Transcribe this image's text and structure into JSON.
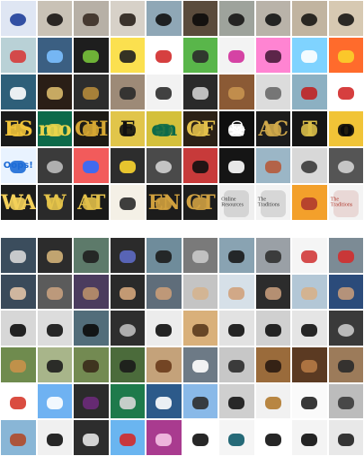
{
  "grids": {
    "top": {
      "rows": [
        [
          {
            "subject": "eye-closeup",
            "bg": "#dfe6f3",
            "fg": "#1f3f9a",
            "label": ""
          },
          {
            "subject": "dog-nose",
            "bg": "#c9c2b6",
            "fg": "#1a1614",
            "label": ""
          },
          {
            "subject": "dog-face",
            "bg": "#b7b0a6",
            "fg": "#3a2e25",
            "label": ""
          },
          {
            "subject": "dog-face",
            "bg": "#d7d1c8",
            "fg": "#2a211b",
            "label": ""
          },
          {
            "subject": "dog-nose",
            "bg": "#8fa7b6",
            "fg": "#121212",
            "label": ""
          },
          {
            "subject": "dog-mouth",
            "bg": "#5a4b3c",
            "fg": "#0c0b0a",
            "label": ""
          },
          {
            "subject": "dog-nose",
            "bg": "#9ea39c",
            "fg": "#161616",
            "label": ""
          },
          {
            "subject": "dog-nose",
            "bg": "#b9b3a9",
            "fg": "#141414",
            "label": ""
          },
          {
            "subject": "dog-nose",
            "bg": "#c1b4a0",
            "fg": "#1a1714",
            "label": ""
          },
          {
            "subject": "dog-nose",
            "bg": "#d7c9b2",
            "fg": "#1a1714",
            "label": ""
          }
        ],
        [
          {
            "subject": "graphic",
            "bg": "#b9d1d6",
            "fg": "#d63b3b",
            "label": ""
          },
          {
            "subject": "graphic",
            "bg": "#3b5f82",
            "fg": "#7cc0ff",
            "label": ""
          },
          {
            "subject": "graphic",
            "bg": "#1e1e1e",
            "fg": "#77c23a",
            "label": ""
          },
          {
            "subject": "graphic",
            "bg": "#fbe04f",
            "fg": "#1f1f1f",
            "label": ""
          },
          {
            "subject": "graphic",
            "bg": "#ffffff",
            "fg": "#d22b2b",
            "label": ""
          },
          {
            "subject": "graphic",
            "bg": "#59b64a",
            "fg": "#2b2b2b",
            "label": ""
          },
          {
            "subject": "graphic",
            "bg": "#f3f3f3",
            "fg": "#d2309b",
            "label": ""
          },
          {
            "subject": "graphic",
            "bg": "#ff84d2",
            "fg": "#4a1b3a",
            "label": ""
          },
          {
            "subject": "graphic",
            "bg": "#7fd3ff",
            "fg": "#ffffff",
            "label": ""
          },
          {
            "subject": "graphic",
            "bg": "#ff6b2c",
            "fg": "#fbd12a",
            "label": ""
          }
        ],
        [
          {
            "subject": "graphic",
            "bg": "#2e5f79",
            "fg": "#ffffff",
            "label": ""
          },
          {
            "subject": "graphic",
            "bg": "#2a1e16",
            "fg": "#d8b86a",
            "label": ""
          },
          {
            "subject": "graphic",
            "bg": "#2d2d2d",
            "fg": "#b48a3b",
            "label": ""
          },
          {
            "subject": "graphic",
            "bg": "#9d8a77",
            "fg": "#2a2a2a",
            "label": ""
          },
          {
            "subject": "graphic",
            "bg": "#f2f2f2",
            "fg": "#2d2d2d",
            "label": ""
          },
          {
            "subject": "graphic",
            "bg": "#2a2a2a",
            "fg": "#cfcfcf",
            "label": ""
          },
          {
            "subject": "graphic",
            "bg": "#8b5a35",
            "fg": "#c6924f",
            "label": ""
          },
          {
            "subject": "graphic",
            "bg": "#dcdcdc",
            "fg": "#6a6a6a",
            "label": ""
          },
          {
            "subject": "graphic",
            "bg": "#8cb0c2",
            "fg": "#c02424",
            "label": ""
          },
          {
            "subject": "graphic",
            "bg": "#ffffff",
            "fg": "#d12a2a",
            "label": ""
          }
        ],
        [
          {
            "subject": "sign-text",
            "bg": "#1b1b1b",
            "fg": "#f1c33a",
            "label": "ES"
          },
          {
            "subject": "sign-text",
            "bg": "#0d6a4a",
            "fg": "#e8d44b",
            "label": "mo"
          },
          {
            "subject": "sign-text",
            "bg": "#1e1b15",
            "fg": "#d6a733",
            "label": "CH"
          },
          {
            "subject": "sign-text",
            "bg": "#e1c54a",
            "fg": "#111111",
            "label": "E"
          },
          {
            "subject": "sign-text",
            "bg": "#d4c03b",
            "fg": "#0d6a4a",
            "label": "en"
          },
          {
            "subject": "sign-text",
            "bg": "#2b2116",
            "fg": "#e3c04a",
            "label": "CF"
          },
          {
            "subject": "sign-text",
            "bg": "#0f0f0f",
            "fg": "#ffffff",
            "label": "☠"
          },
          {
            "subject": "sign-text",
            "bg": "#1c1c1c",
            "fg": "#cfa84a",
            "label": "AC"
          },
          {
            "subject": "sign-text",
            "bg": "#151515",
            "fg": "#d8bd48",
            "label": "T"
          },
          {
            "subject": "sign-text",
            "bg": "#f1c437",
            "fg": "#0b0b0b",
            "label": "o"
          }
        ],
        [
          {
            "subject": "sticker-text",
            "bg": "#e9f3ff",
            "fg": "#1d6bd6",
            "label": "Oops!"
          },
          {
            "subject": "wheel",
            "bg": "#3b3b3b",
            "fg": "#bdbdbd",
            "label": ""
          },
          {
            "subject": "graphic",
            "bg": "#f25b5b",
            "fg": "#2d6bff",
            "label": ""
          },
          {
            "subject": "graphic",
            "bg": "#2d2d2d",
            "fg": "#fbd52f",
            "label": ""
          },
          {
            "subject": "wheel",
            "bg": "#4a4a4a",
            "fg": "#d1d1d1",
            "label": ""
          },
          {
            "subject": "graphic",
            "bg": "#c73a3a",
            "fg": "#111111",
            "label": ""
          },
          {
            "subject": "graphic",
            "bg": "#151515",
            "fg": "#ffffff",
            "label": ""
          },
          {
            "subject": "graphic",
            "bg": "#9bb6c6",
            "fg": "#b65a3a",
            "label": ""
          },
          {
            "subject": "wheel",
            "bg": "#d8d8d8",
            "fg": "#3b3b3b",
            "label": ""
          },
          {
            "subject": "wheel",
            "bg": "#555555",
            "fg": "#d3d3d3",
            "label": ""
          }
        ],
        [
          {
            "subject": "sign-text",
            "bg": "#1c1c1c",
            "fg": "#f3d05a",
            "label": "WA"
          },
          {
            "subject": "sign-text",
            "bg": "#2a2a2a",
            "fg": "#e4c34a",
            "label": "W"
          },
          {
            "subject": "sign-text",
            "bg": "#1a1a1a",
            "fg": "#e1bf49",
            "label": "AT"
          },
          {
            "subject": "graphic",
            "bg": "#f4f0e6",
            "fg": "#2a2a2a",
            "label": ""
          },
          {
            "subject": "sign-text",
            "bg": "#1c1c1c",
            "fg": "#d1a13e",
            "label": "EN"
          },
          {
            "subject": "sign-text",
            "bg": "#1d1d1d",
            "fg": "#d0a142",
            "label": "CT"
          },
          {
            "subject": "paper",
            "bg": "#efefef",
            "fg": "#3a3a3a",
            "label": "Online Resources"
          },
          {
            "subject": "paper",
            "bg": "#f3f3f3",
            "fg": "#3a3a3a",
            "label": "The Traditions"
          },
          {
            "subject": "graphic",
            "bg": "#f3a02b",
            "fg": "#b03a2e",
            "label": ""
          },
          {
            "subject": "paper",
            "bg": "#f4f4f4",
            "fg": "#b03a2e",
            "label": "The Traditions"
          }
        ]
      ]
    },
    "bottom": {
      "rows": [
        [
          {
            "subject": "photo",
            "bg": "#3b4d5d",
            "fg": "#d7d7d7",
            "label": ""
          },
          {
            "subject": "photo",
            "bg": "#2c2c2c",
            "fg": "#d2b178",
            "label": ""
          },
          {
            "subject": "photo",
            "bg": "#5d7a6a",
            "fg": "#1f1f1f",
            "label": ""
          },
          {
            "subject": "photo",
            "bg": "#2b2b2b",
            "fg": "#5d6ac4",
            "label": ""
          },
          {
            "subject": "photo",
            "bg": "#6f8c9b",
            "fg": "#1c1c1c",
            "label": ""
          },
          {
            "subject": "photo",
            "bg": "#7a7a7a",
            "fg": "#c9c9c9",
            "label": ""
          },
          {
            "subject": "photo",
            "bg": "#89a3b2",
            "fg": "#1a1a1a",
            "label": ""
          },
          {
            "subject": "photo",
            "bg": "#9aa0a6",
            "fg": "#313131",
            "label": ""
          },
          {
            "subject": "photo",
            "bg": "#f5f5f5",
            "fg": "#d23a3a",
            "label": ""
          },
          {
            "subject": "photo",
            "bg": "#7c8b95",
            "fg": "#d22d2d",
            "label": ""
          }
        ],
        [
          {
            "subject": "portrait",
            "bg": "#3a4a5a",
            "fg": "#e0c2a6",
            "label": ""
          },
          {
            "subject": "portrait",
            "bg": "#5b5b5b",
            "fg": "#c7a07e",
            "label": ""
          },
          {
            "subject": "portrait",
            "bg": "#4b3c5e",
            "fg": "#b98f6a",
            "label": ""
          },
          {
            "subject": "portrait",
            "bg": "#2a2a2a",
            "fg": "#d3a57b",
            "label": ""
          },
          {
            "subject": "portrait",
            "bg": "#5f6d7a",
            "fg": "#c99c78",
            "label": ""
          },
          {
            "subject": "portrait",
            "bg": "#c4c4c4",
            "fg": "#d5b48f",
            "label": ""
          },
          {
            "subject": "portrait",
            "bg": "#d6e0e8",
            "fg": "#d0a27c",
            "label": ""
          },
          {
            "subject": "portrait",
            "bg": "#2c2c2c",
            "fg": "#c39a7a",
            "label": ""
          },
          {
            "subject": "portrait",
            "bg": "#b3c7d6",
            "fg": "#d6b08a",
            "label": ""
          },
          {
            "subject": "portrait",
            "bg": "#2b4b7a",
            "fg": "#c39a7a",
            "label": ""
          }
        ],
        [
          {
            "subject": "car",
            "bg": "#d7d7d7",
            "fg": "#0e0e0e",
            "label": ""
          },
          {
            "subject": "car",
            "bg": "#dcdcdc",
            "fg": "#121212",
            "label": ""
          },
          {
            "subject": "car",
            "bg": "#526d7a",
            "fg": "#0b0b0b",
            "label": ""
          },
          {
            "subject": "wheel",
            "bg": "#2e2e2e",
            "fg": "#bdbdbd",
            "label": ""
          },
          {
            "subject": "car",
            "bg": "#ececec",
            "fg": "#0e0e0e",
            "label": ""
          },
          {
            "subject": "cat",
            "bg": "#d9b07a",
            "fg": "#5a3b1d",
            "label": ""
          },
          {
            "subject": "car",
            "bg": "#e2e2e2",
            "fg": "#0f0f0f",
            "label": ""
          },
          {
            "subject": "car",
            "bg": "#d0d0d0",
            "fg": "#101010",
            "label": ""
          },
          {
            "subject": "car",
            "bg": "#e5e5e5",
            "fg": "#111111",
            "label": ""
          },
          {
            "subject": "wheel",
            "bg": "#3a3a3a",
            "fg": "#c9c9c9",
            "label": ""
          }
        ],
        [
          {
            "subject": "dog",
            "bg": "#6f8b4e",
            "fg": "#c9914a",
            "label": ""
          },
          {
            "subject": "dog",
            "bg": "#a8b58a",
            "fg": "#1d1d1d",
            "label": ""
          },
          {
            "subject": "dog",
            "bg": "#738a52",
            "fg": "#3a2a1a",
            "label": ""
          },
          {
            "subject": "animal",
            "bg": "#4b6b3b",
            "fg": "#1b1b1b",
            "label": ""
          },
          {
            "subject": "dog",
            "bg": "#c4a27a",
            "fg": "#6a3b1b",
            "label": ""
          },
          {
            "subject": "dog",
            "bg": "#6d7a86",
            "fg": "#ffffff",
            "label": ""
          },
          {
            "subject": "dog",
            "bg": "#c7c7c7",
            "fg": "#2b2b2b",
            "label": ""
          },
          {
            "subject": "dog",
            "bg": "#9a6b3b",
            "fg": "#2a1b12",
            "label": ""
          },
          {
            "subject": "animal",
            "bg": "#5b3a22",
            "fg": "#b57a45",
            "label": ""
          },
          {
            "subject": "dog",
            "bg": "#9c7b5a",
            "fg": "#2a2a2a",
            "label": ""
          }
        ],
        [
          {
            "subject": "graphic",
            "bg": "#ffffff",
            "fg": "#d63a2c",
            "label": ""
          },
          {
            "subject": "tower",
            "bg": "#6fb2f2",
            "fg": "#ffffff",
            "label": ""
          },
          {
            "subject": "tower",
            "bg": "#2b2b2b",
            "fg": "#6b2a7a",
            "label": ""
          },
          {
            "subject": "graphic",
            "bg": "#1e7a4b",
            "fg": "#d7d7d7",
            "label": ""
          },
          {
            "subject": "car",
            "bg": "#2c5a8a",
            "fg": "#ffffff",
            "label": ""
          },
          {
            "subject": "tower",
            "bg": "#89b9e8",
            "fg": "#2d2d2d",
            "label": ""
          },
          {
            "subject": "tower",
            "bg": "#cfcfcf",
            "fg": "#151515",
            "label": ""
          },
          {
            "subject": "basket",
            "bg": "#f1f1f1",
            "fg": "#b17a2f",
            "label": ""
          },
          {
            "subject": "tower",
            "bg": "#fafafa",
            "fg": "#222222",
            "label": ""
          },
          {
            "subject": "tower",
            "bg": "#bcbcbc",
            "fg": "#3b3b3b",
            "label": ""
          }
        ],
        [
          {
            "subject": "person",
            "bg": "#89b6d6",
            "fg": "#b04a2a",
            "label": ""
          },
          {
            "subject": "animal",
            "bg": "#f0f0f0",
            "fg": "#111111",
            "label": ""
          },
          {
            "subject": "animal",
            "bg": "#2d2d2d",
            "fg": "#e5e5e5",
            "label": ""
          },
          {
            "subject": "graphic",
            "bg": "#6ab5f0",
            "fg": "#d12a2a",
            "label": ""
          },
          {
            "subject": "flower",
            "bg": "#a93b8f",
            "fg": "#f5c2e4",
            "label": ""
          },
          {
            "subject": "teapot",
            "bg": "#ffffff",
            "fg": "#0f0f0f",
            "label": ""
          },
          {
            "subject": "teapot",
            "bg": "#f5f5f5",
            "fg": "#0f5b6a",
            "label": ""
          },
          {
            "subject": "teapot",
            "bg": "#ffffff",
            "fg": "#101010",
            "label": ""
          },
          {
            "subject": "teapot",
            "bg": "#f4f4f4",
            "fg": "#0d0d0d",
            "label": ""
          },
          {
            "subject": "teapot",
            "bg": "#e8e8e8",
            "fg": "#202020",
            "label": ""
          }
        ]
      ]
    }
  }
}
